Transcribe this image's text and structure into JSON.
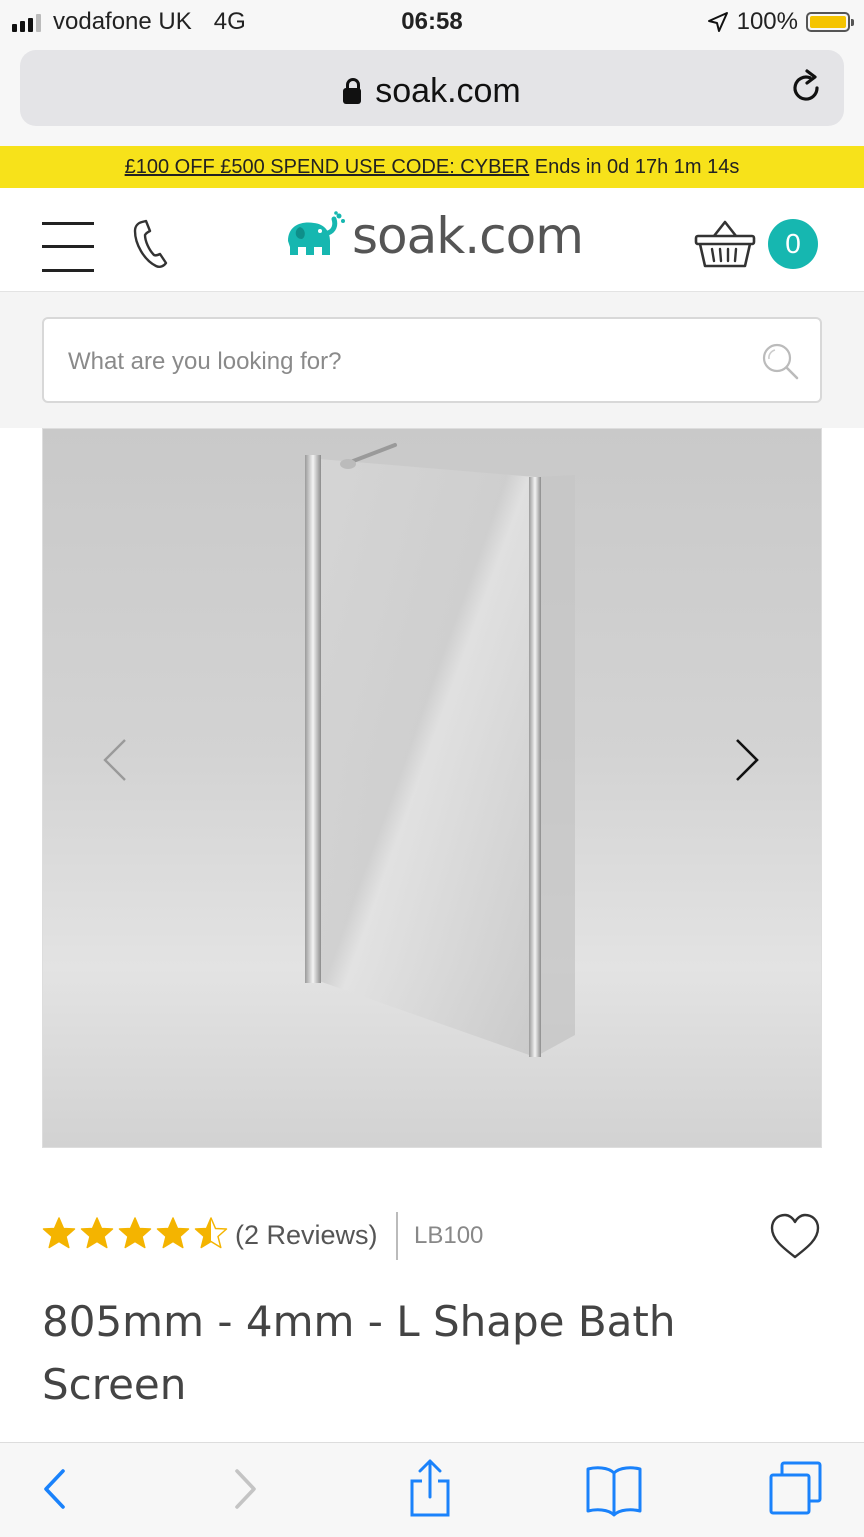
{
  "status_bar": {
    "carrier": "vodafone UK",
    "network": "4G",
    "time": "06:58",
    "battery": "100%",
    "battery_color": "#f5c400"
  },
  "browser": {
    "url": "soak.com",
    "reload_icon": "reload-icon",
    "lock_icon": "lock-icon"
  },
  "promo": {
    "code_text": "£100 OFF £500 SPEND USE CODE: CYBER",
    "countdown": "Ends in 0d 17h 1m 14s",
    "background": "#f7e21a"
  },
  "header": {
    "menu_icon": "hamburger-menu-icon",
    "phone_icon": "phone-icon",
    "logo_text": "soak.com",
    "logo_color": "#16b7b0",
    "basket_icon": "basket-icon",
    "cart_count": "0"
  },
  "search": {
    "placeholder": "What are you looking for?",
    "icon": "search-icon"
  },
  "gallery": {
    "prev_icon": "chevron-left-icon",
    "next_icon": "chevron-right-icon",
    "image": "bath-screen-product-image"
  },
  "product": {
    "rating": 4.5,
    "rating_max": 5,
    "star_color": "#f4b400",
    "reviews": "(2 Reviews)",
    "sku": "LB100",
    "wishlist_icon": "heart-icon",
    "title": "805mm - 4mm - L Shape Bath Screen"
  },
  "toolbar": {
    "icons": [
      "back-icon",
      "forward-icon",
      "share-icon",
      "bookmarks-icon",
      "tabs-icon"
    ],
    "accent": "#1a82fb"
  }
}
